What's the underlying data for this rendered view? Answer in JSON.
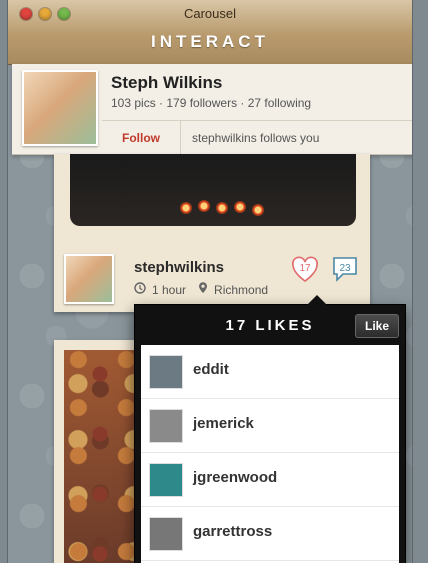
{
  "window": {
    "title": "Carousel",
    "brand": "INTERACT"
  },
  "profile": {
    "name": "Steph Wilkins",
    "stats": "103 pics · 179 followers · 27 following",
    "follow_label": "Follow",
    "follows_you": "stephwilkins follows you"
  },
  "post": {
    "username": "stephwilkins",
    "time": "1 hour",
    "location": "Richmond",
    "likes": "17",
    "comments": "23"
  },
  "likes_popup": {
    "title": "17 LIKES",
    "like_button": "Like",
    "users": [
      {
        "name": "eddit",
        "thumb_color": "#6c7a83"
      },
      {
        "name": "jemerick",
        "thumb_color": "#8a8a8a"
      },
      {
        "name": "jgreenwood",
        "thumb_color": "#2e8a8a"
      },
      {
        "name": "garrettross",
        "thumb_color": "#777777"
      }
    ]
  },
  "colors": {
    "accent_red": "#c0392b",
    "heart": "#e06b6b",
    "comment": "#4a88a6",
    "titlebar_wood": "#b89a6d"
  }
}
